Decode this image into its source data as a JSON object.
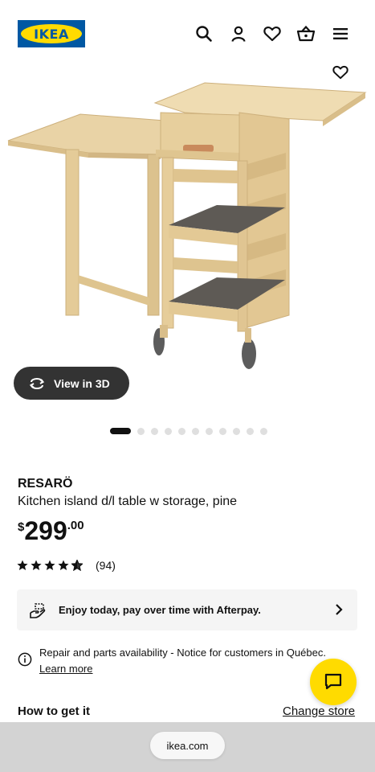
{
  "header": {
    "logo_text": "IKEA",
    "icons": [
      "search-icon",
      "account-icon",
      "wishlist-icon",
      "cart-icon",
      "menu-icon"
    ]
  },
  "gallery": {
    "favorite_icon": "heart-icon",
    "view3d_label": "View in 3D",
    "image_count": 11,
    "active_image_index": 0
  },
  "product": {
    "name": "RESARÖ",
    "description": "Kitchen island d/l table w storage, pine",
    "price_currency": "$",
    "price_integer": "299",
    "price_decimal": ".00",
    "rating_stars": 4.5,
    "rating_count": "(94)"
  },
  "afterpay": {
    "text": "Enjoy today, pay over time with Afterpay."
  },
  "notice": {
    "text": "Repair and parts availability - Notice for customers in Québec.",
    "link": "Learn more"
  },
  "delivery": {
    "title": "How to get it",
    "change_store": "Change store"
  },
  "browser": {
    "url": "ikea.com"
  },
  "colors": {
    "ikea_blue": "#0058a3",
    "ikea_yellow": "#ffdb00",
    "view3d_bg": "#333333",
    "afterpay_bg": "#f5f5f5",
    "browser_bar": "#d3d3d3"
  }
}
